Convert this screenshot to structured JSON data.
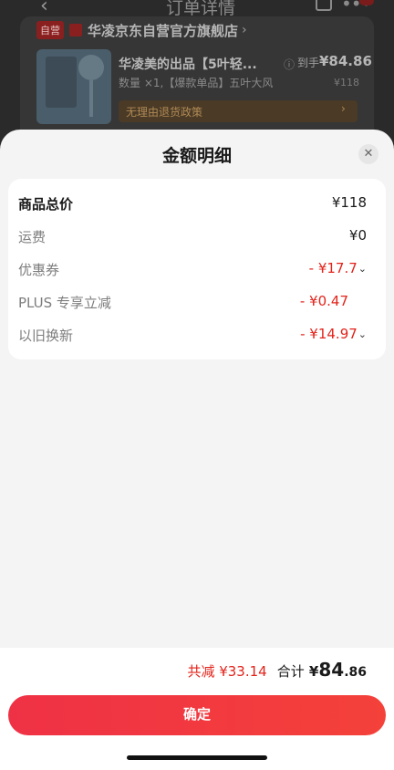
{
  "background": {
    "back_icon": "chevron-left-icon",
    "title": "订单详情",
    "store_badge": "自营",
    "store_name": "华凌京东自营官方旗舰店",
    "store_chevron": "›",
    "product_name": "华凌美的出品【5叶轻...",
    "product_spec": "数量 ×1,【爆款单品】五叶大风",
    "price_info_icon": "ⓘ",
    "price_prefix": "到手",
    "price": "¥84.86",
    "original_price": "¥118",
    "policy_text": "无理由退货政策"
  },
  "sheet": {
    "title": "金额明细",
    "close_icon": "close-icon",
    "rows": [
      {
        "label": "商品总价",
        "value": "¥118"
      },
      {
        "label": "运费",
        "value": "¥0"
      },
      {
        "label": "优惠券",
        "value": "- ¥17.7"
      },
      {
        "label": "PLUS 专享立减",
        "value": "- ¥0.47"
      },
      {
        "label": "以旧换新",
        "value": "- ¥14.97"
      }
    ]
  },
  "footer": {
    "saved": "共减 ¥33.14",
    "total_label": "合计",
    "total_yen": "¥",
    "total_int": "84",
    "total_dec": ".86",
    "confirm_label": "确定"
  },
  "colors": {
    "accent_red": "#e2231a",
    "button_gradient_start": "#ef3145",
    "button_gradient_end": "#f4413a",
    "sheet_bg": "#f4f4f4"
  }
}
